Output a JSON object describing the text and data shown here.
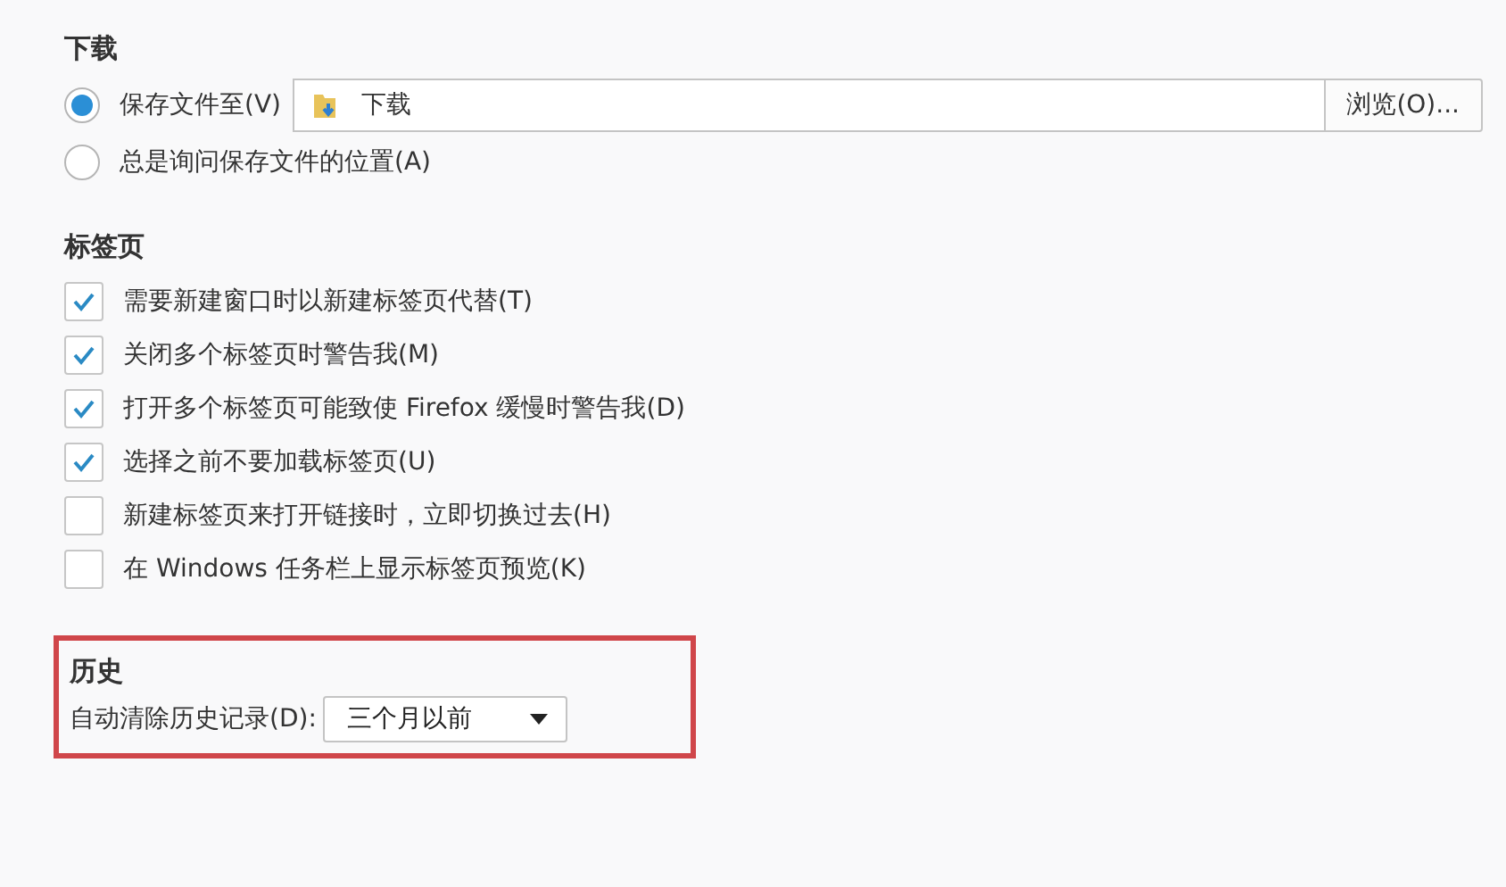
{
  "downloads": {
    "heading": "下载",
    "options": [
      {
        "label": "保存文件至(V)",
        "selected": true,
        "kind": "folder",
        "folder": "下载",
        "button": "浏览(O)..."
      },
      {
        "label": "总是询问保存文件的位置(A)",
        "selected": false,
        "kind": "plain"
      }
    ]
  },
  "tabs": {
    "heading": "标签页",
    "options": [
      {
        "label": "需要新建窗口时以新建标签页代替(T)",
        "checked": true
      },
      {
        "label": "关闭多个标签页时警告我(M)",
        "checked": true
      },
      {
        "label": "打开多个标签页可能致使 Firefox 缓慢时警告我(D)",
        "checked": true
      },
      {
        "label": "选择之前不要加载标签页(U)",
        "checked": true
      },
      {
        "label": "新建标签页来打开链接时，立即切换过去(H)",
        "checked": false
      },
      {
        "label": "在 Windows 任务栏上显示标签页预览(K)",
        "checked": false
      }
    ]
  },
  "history": {
    "heading": "历史",
    "highlighted": true,
    "label": "自动清除历史记录(D):",
    "value": "三个月以前"
  }
}
